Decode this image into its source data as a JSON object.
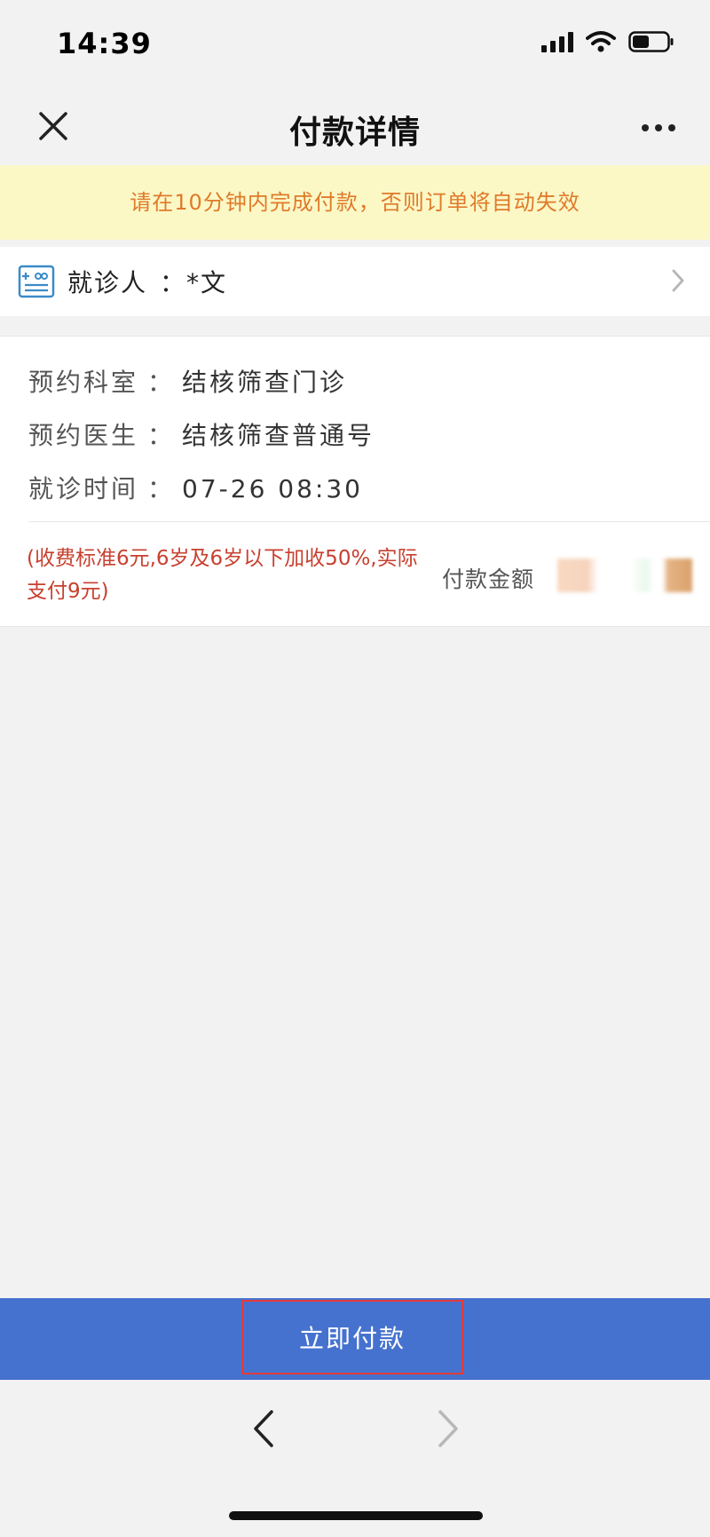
{
  "status_bar": {
    "time": "14:39",
    "icons": [
      "signal-icon",
      "wifi-icon",
      "battery-icon"
    ]
  },
  "nav": {
    "title": "付款详情",
    "close_icon": "close-icon",
    "more_icon": "more-icon"
  },
  "warning": "请在10分钟内完成付款，否则订单将自动失效",
  "patient": {
    "label": "就诊人",
    "separator": "：",
    "value": "*文"
  },
  "details": [
    {
      "label": "预约科室",
      "separator": "：",
      "value": "结核筛查门诊"
    },
    {
      "label": "预约医生",
      "separator": "：",
      "value": "结核筛查普通号"
    },
    {
      "label": "就诊时间",
      "separator": "：",
      "value": "07-26 08:30"
    }
  ],
  "fee_note": "(收费标准6元,6岁及6岁以下加收50%,实际支付9元)",
  "amount_label": "付款金额",
  "pay_button": "立即付款",
  "colors": {
    "accent_blue": "#4672cf",
    "warning_text": "#e07a2a",
    "warning_bg": "#fbf8c6",
    "fee_red": "#c8402f",
    "highlight_border": "#e23b3b"
  }
}
